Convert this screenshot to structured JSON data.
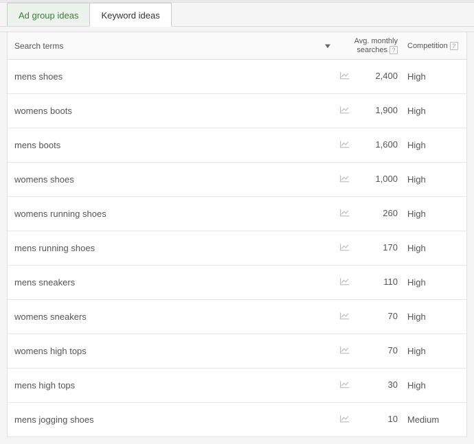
{
  "tabs": {
    "ad_group": "Ad group ideas",
    "keyword": "Keyword ideas"
  },
  "headers": {
    "search_terms": "Search terms",
    "avg_line1": "Avg. monthly",
    "avg_line2": "searches",
    "competition": "Competition"
  },
  "rows": [
    {
      "term": "mens shoes",
      "searches": "2,400",
      "competition": "High"
    },
    {
      "term": "womens boots",
      "searches": "1,900",
      "competition": "High"
    },
    {
      "term": "mens boots",
      "searches": "1,600",
      "competition": "High"
    },
    {
      "term": "womens shoes",
      "searches": "1,000",
      "competition": "High"
    },
    {
      "term": "womens running shoes",
      "searches": "260",
      "competition": "High"
    },
    {
      "term": "mens running shoes",
      "searches": "170",
      "competition": "High"
    },
    {
      "term": "mens sneakers",
      "searches": "110",
      "competition": "High"
    },
    {
      "term": "womens sneakers",
      "searches": "70",
      "competition": "High"
    },
    {
      "term": "womens high tops",
      "searches": "70",
      "competition": "High"
    },
    {
      "term": "mens high tops",
      "searches": "30",
      "competition": "High"
    },
    {
      "term": "mens jogging shoes",
      "searches": "10",
      "competition": "Medium"
    }
  ]
}
